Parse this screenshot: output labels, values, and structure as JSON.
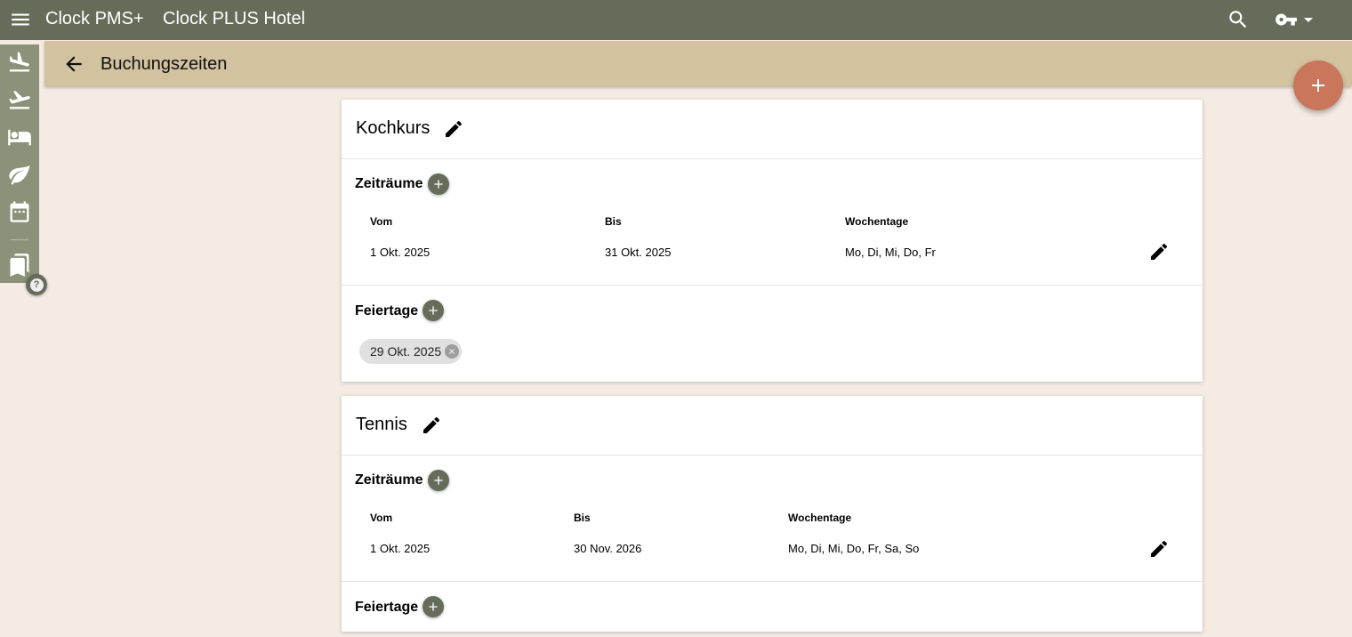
{
  "app": {
    "brand": "Clock PMS+",
    "hotel": "Clock PLUS Hotel"
  },
  "header": {
    "title": "Buchungszeiten"
  },
  "sidebar": {
    "items": [
      {
        "icon": "flight-land-icon"
      },
      {
        "icon": "flight-takeoff-icon"
      },
      {
        "icon": "bed-icon"
      },
      {
        "icon": "leaf-icon"
      },
      {
        "icon": "calendar-icon"
      },
      {
        "icon": "bookmarks-icon"
      }
    ],
    "help_label": "?"
  },
  "colors": {
    "topbar": "#656d5a",
    "subbar": "#d2c29f",
    "fab": "#c9765b",
    "background": "#f4ebe3"
  },
  "cards": [
    {
      "title": "Kochkurs",
      "periods_label": "Zeiträume",
      "columns": [
        "Vom",
        "Bis",
        "Wochentage"
      ],
      "rows": [
        {
          "from": "1 Okt. 2025",
          "to": "31 Okt. 2025",
          "weekdays": "Mo, Di, Mi, Do, Fr"
        }
      ],
      "holidays_label": "Feiertage",
      "holidays": [
        "29 Okt. 2025"
      ]
    },
    {
      "title": "Tennis",
      "periods_label": "Zeiträume",
      "columns": [
        "Vom",
        "Bis",
        "Wochentage"
      ],
      "rows": [
        {
          "from": "1 Okt. 2025",
          "to": "30 Nov. 2026",
          "weekdays": "Mo, Di, Mi, Do, Fr, Sa, So"
        }
      ],
      "holidays_label": "Feiertage",
      "holidays": []
    }
  ]
}
